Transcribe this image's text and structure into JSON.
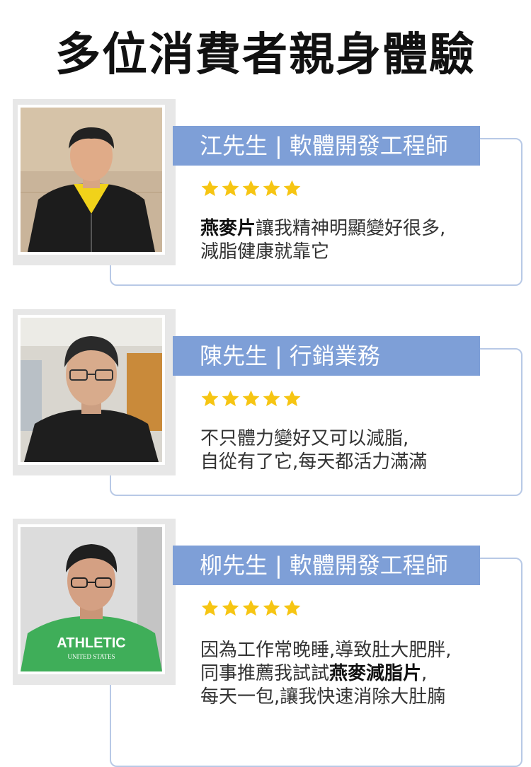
{
  "title": "多位消費者親身體驗",
  "colors": {
    "accent": "#7e9fd7",
    "star": "#f6c513",
    "outline": "#b8c9e6"
  },
  "star_count": 5,
  "testimonials": [
    {
      "name": "江先生",
      "separator": "|",
      "job": "軟體開發工程師",
      "rating": 5,
      "quote": [
        {
          "bold": "燕麥片",
          "text": "讓我精神明顯變好很多,"
        },
        {
          "bold": "",
          "text": "減脂健康就靠它"
        }
      ]
    },
    {
      "name": "陳先生",
      "separator": "|",
      "job": "行銷業務",
      "rating": 5,
      "quote": [
        {
          "bold": "",
          "text": "不只體力變好又可以減脂,"
        },
        {
          "bold": "",
          "text": "自從有了它,每天都活力滿滿"
        }
      ]
    },
    {
      "name": "柳先生",
      "separator": "|",
      "job": "軟體開發工程師",
      "rating": 5,
      "shirt_text": "ATHLETIC",
      "shirt_subtext": "UNITED STATES",
      "quote": [
        {
          "bold": "",
          "text": "因為工作常晚睡,導致肚大肥胖,"
        },
        {
          "bold": "燕麥減脂片",
          "text": ",",
          "prefix": "同事推薦我試試"
        },
        {
          "bold": "",
          "text": "每天一包,讓我快速消除大肚腩"
        }
      ]
    }
  ]
}
